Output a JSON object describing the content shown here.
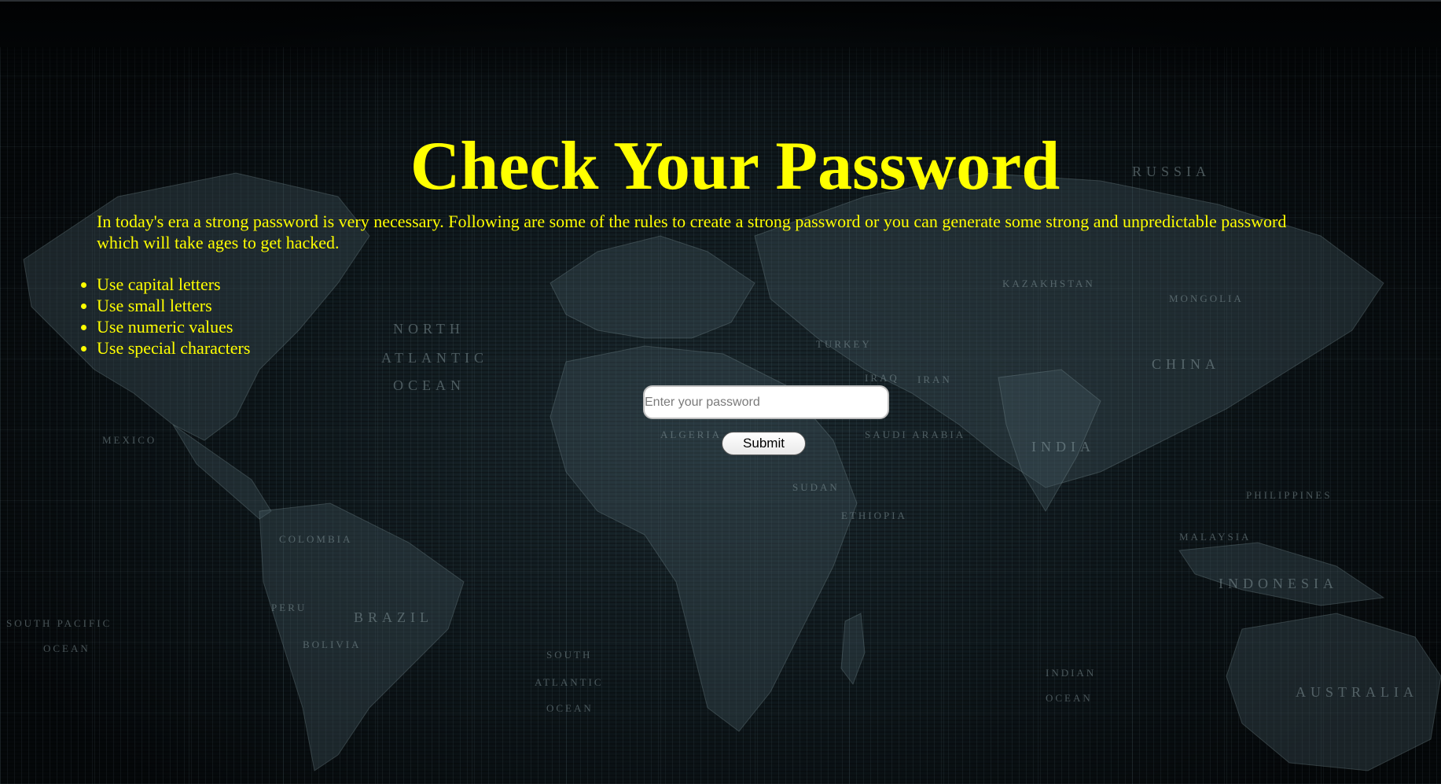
{
  "header": {
    "title": "Check Your Password"
  },
  "intro": {
    "text": "In today's era a strong password is very necessary. Following are some of the rules to create a strong password or you can generate some strong and unpredictable password which will take ages to get hacked."
  },
  "rules": {
    "items": [
      {
        "label": "Use capital letters"
      },
      {
        "label": "Use small letters"
      },
      {
        "label": "Use numeric values"
      },
      {
        "label": "Use special characters"
      }
    ]
  },
  "form": {
    "password_value": "",
    "password_placeholder": "Enter your password",
    "submit_label": "Submit"
  },
  "background": {
    "map_labels": [
      "RUSSIA",
      "NORTH",
      "ATLANTIC",
      "OCEAN",
      "CHINA",
      "MONGOLIA",
      "KAZAKHSTAN",
      "IRAN",
      "SAUDI ARABIA",
      "SUDAN",
      "ETHIOPIA",
      "INDIA",
      "INDONESIA",
      "AUSTRALIA",
      "BRAZIL",
      "SOUTH",
      "ATLANTIC",
      "OCEAN",
      "SOUTH PACIFIC",
      "OCEAN",
      "INDIAN",
      "OCEAN",
      "MEXICO",
      "COLOMBIA",
      "PERU",
      "BOLIVIA",
      "ALGERIA",
      "PHILIPPINES",
      "MALAYSIA",
      "TURKEY",
      "IRAQ"
    ]
  },
  "colors": {
    "accent_text": "#ffff00",
    "background": "#0e171b"
  }
}
